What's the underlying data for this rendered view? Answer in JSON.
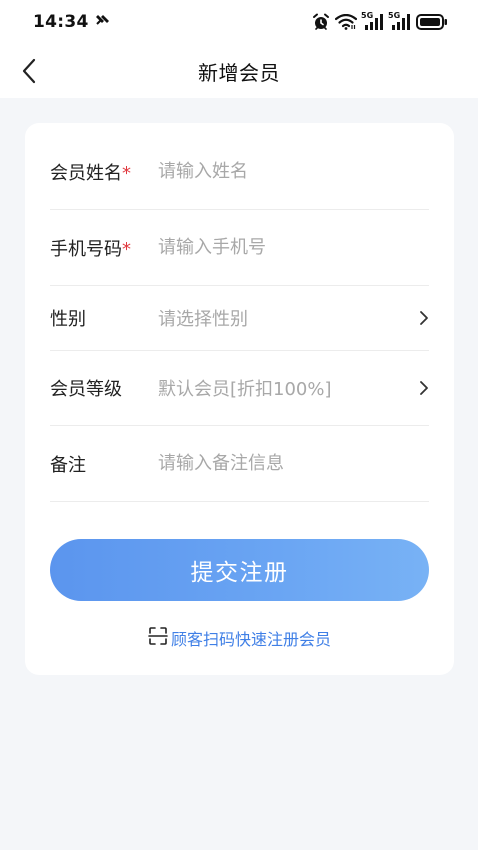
{
  "status_bar": {
    "time": "14:34",
    "signal_1_label": "5G",
    "signal_2_label": "5G"
  },
  "nav": {
    "title": "新增会员"
  },
  "form": {
    "name": {
      "label": "会员姓名",
      "required_mark": "*",
      "placeholder": "请输入姓名"
    },
    "phone": {
      "label": "手机号码",
      "required_mark": "*",
      "placeholder": "请输入手机号"
    },
    "gender": {
      "label": "性别",
      "placeholder": "请选择性别"
    },
    "level": {
      "label": "会员等级",
      "placeholder": "默认会员[折扣100%]"
    },
    "remark": {
      "label": "备注",
      "placeholder": "请输入备注信息"
    }
  },
  "actions": {
    "submit_label": "提交注册",
    "scan_link_label": "顾客扫码快速注册会员"
  },
  "colors": {
    "accent": "#5b95ee",
    "link": "#3f7fe6",
    "required": "#e0383e",
    "background": "#f4f6f9"
  },
  "icons": {
    "back": "chevron-left-icon",
    "select": "chevron-right-icon",
    "scan": "scan-icon"
  }
}
